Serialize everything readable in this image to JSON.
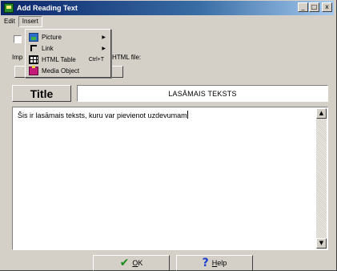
{
  "window": {
    "title": "Add Reading Text",
    "controls": {
      "minimize": "_",
      "maximize": "□",
      "close": "x"
    }
  },
  "menubar": {
    "items": [
      "Edit",
      "Insert"
    ],
    "active": "Insert"
  },
  "insert_menu": {
    "items": [
      {
        "label": "Picture",
        "icon": "picture-icon",
        "submenu": true,
        "shortcut": ""
      },
      {
        "label": "Link",
        "icon": "link-icon",
        "submenu": true,
        "shortcut": ""
      },
      {
        "label": "HTML Table",
        "icon": "table-icon",
        "submenu": false,
        "shortcut": "Ctrl+T"
      },
      {
        "label": "Media Object",
        "icon": "media-object-icon",
        "submenu": false,
        "shortcut": ""
      }
    ]
  },
  "import": {
    "label_prefix": "Imp",
    "label_suffix": "HTML file:"
  },
  "title_section": {
    "button_label": "Title",
    "value": "LASĀMAIS TEKSTS"
  },
  "body_text": {
    "value": "Šis ir lasāmais teksts, kuru var pievienot uzdevumam"
  },
  "buttons": {
    "ok": {
      "mnemonic": "O",
      "rest": "K"
    },
    "help": {
      "mnemonic": "H",
      "rest": "elp"
    }
  },
  "colors": {
    "face": "#d4d0c8",
    "title_bar_start": "#0a246a",
    "ok_check": "#1a8a1a",
    "help_question": "#1a3ecf"
  }
}
